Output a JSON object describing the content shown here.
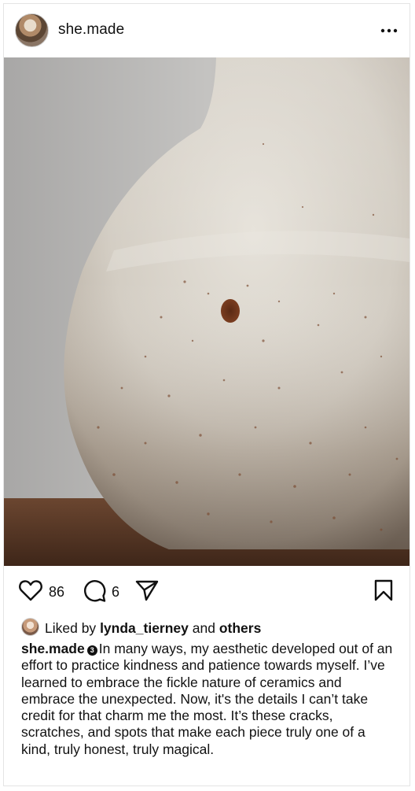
{
  "post": {
    "username": "she.made",
    "avatar_icon": "profile-photo",
    "more_icon": "ellipsis-horizontal-icon",
    "photo_description_colors": {
      "background": "#b9b8b6",
      "vase": "#d8d3ca",
      "table": "#5a3a28"
    }
  },
  "actions": {
    "like_count": "86",
    "comment_count": "6",
    "like_icon": "heart-icon",
    "comment_icon": "comment-bubble-icon",
    "share_icon": "send-paper-plane-icon",
    "save_icon": "bookmark-icon"
  },
  "likes": {
    "prefix": "Liked by",
    "user": "lynda_tierney",
    "conjunction": "and",
    "others": "others"
  },
  "caption": {
    "username": "she.made",
    "badge": "3",
    "text": "In many ways, my aesthetic developed out of an effort to practice kindness and patience towards myself. I’ve learned to embrace the fickle nature of ceramics and embrace the unexpected. Now, it's the details I can’t take credit for that charm me the most. It’s these cracks, scratches, and spots that make each piece truly one of a kind, truly honest, truly magical."
  }
}
